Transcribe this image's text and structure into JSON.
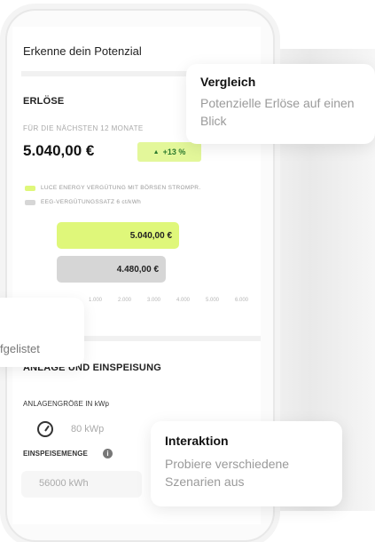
{
  "screen": {
    "title": "Erkenne dein Potenzial"
  },
  "revenue": {
    "heading": "ERLÖSE",
    "caption": "FÜR DIE NÄCHSTEN 12 MONATE",
    "total": "5.040,00 €",
    "growth": "+13 %",
    "growth_arrow": "▲",
    "legend": [
      {
        "label": "LUCE ENERGY VERGÜTUNG MIT BÖRSEN STROMPR.",
        "color": "#dff77a"
      },
      {
        "label": "EEG-VERGÜTUNGSSATZ 6 ct/kWh",
        "color": "#d6d6d6"
      }
    ]
  },
  "chart_data": {
    "type": "bar",
    "orientation": "horizontal",
    "categories": [
      "LUCE ENERGY VERGÜTUNG MIT BÖRSEN STROMPR.",
      "EEG-VERGÜTUNGSSATZ 6 ct/kWh"
    ],
    "values": [
      5040,
      4480
    ],
    "value_labels": [
      "5.040,00 €",
      "4.480,00 €"
    ],
    "colors": [
      "#dff77a",
      "#d6d6d6"
    ],
    "xlim": [
      0,
      6000
    ],
    "ticks": [
      "1.000",
      "2.000",
      "3.000",
      "4.000",
      "5.000",
      "6.000"
    ]
  },
  "system": {
    "heading": "ANLAGE UND EINSPEISUNG",
    "size_label": "ANLAGENGRÖßE IN kWp",
    "size_value": "80 kWp",
    "feed_label": "EINSPEISEMENGE",
    "feed_value": "56000 kWh",
    "info_glyph": "i"
  },
  "callouts": {
    "compare": {
      "title": "Vergleich",
      "body": "Potenzielle Erlöse auf einen Blick"
    },
    "interaction": {
      "title": "Interaktion",
      "body": "Probiere verschiedene Szenarien aus"
    },
    "left_partial": "fgelistet"
  },
  "icons": {
    "gauge": "gauge-icon",
    "info": "info-icon",
    "trend": "arrow-up-icon"
  }
}
